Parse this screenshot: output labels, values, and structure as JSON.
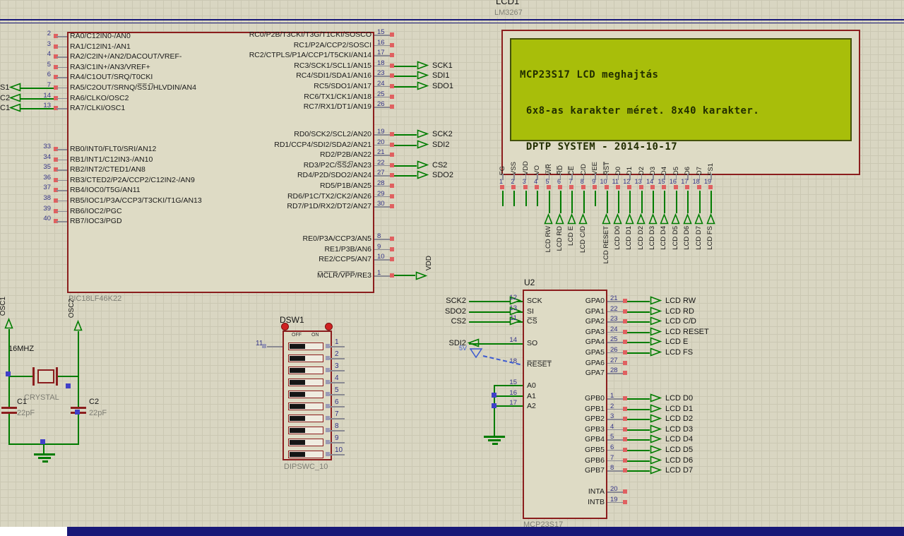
{
  "colors": {
    "background": "#d9d6c2",
    "grid": "#cbc8b3",
    "component_border": "#8b1d1d",
    "component_fill": "#dedbc5",
    "wire_green": "#007c00",
    "lcd_screen": "#a8be0a",
    "lcd_text": "#222e00",
    "sheet_border_blue": "#181878",
    "pin_number_blue": "#333388",
    "value_gray": "#7e7e74",
    "power_flag_blue": "#3c5ad0",
    "pin_endpoint_red": "#e06060",
    "junction_blue": "#4040c8"
  },
  "pic": {
    "value": "PIC18LF46K22",
    "mclr_power": "VDD",
    "left_a": [
      {
        "num": "2",
        "name": "RA0/C12IN0-/AN0"
      },
      {
        "num": "3",
        "name": "RA1/C12IN1-/AN1"
      },
      {
        "num": "4",
        "name": "RA2/C2IN+/AN2/DACOUT/VREF-"
      },
      {
        "num": "5",
        "name": "RA3/C1IN+/AN3/VREF+"
      },
      {
        "num": "6",
        "name": "RA4/C1OUT/SRQ/T0CKI"
      },
      {
        "num": "7",
        "name": "RA5/C2OUT/SRNQ/S̅S̅1̅/HLVDIN/AN4",
        "frag": "S1",
        "wire": "1"
      },
      {
        "num": "14",
        "name": "RA6/CLKO/OSC2",
        "frag": "C2",
        "wire": "1"
      },
      {
        "num": "13",
        "name": "RA7/CLKI/OSC1",
        "frag": "C1",
        "wire": "1"
      }
    ],
    "left_b": [
      {
        "num": "33",
        "name": "RB0/INT0/FLT0/SRI/AN12"
      },
      {
        "num": "34",
        "name": "RB1/INT1/C12IN3-/AN10"
      },
      {
        "num": "35",
        "name": "RB2/INT2/CTED1/AN8"
      },
      {
        "num": "36",
        "name": "RB3/CTED2/P2A/CCP2/C12IN2-/AN9"
      },
      {
        "num": "37",
        "name": "RB4/IOC0/T5G/AN11"
      },
      {
        "num": "38",
        "name": "RB5/IOC1/P3A/CCP3/T3CKI/T1G/AN13"
      },
      {
        "num": "39",
        "name": "RB6/IOC2/PGC"
      },
      {
        "num": "40",
        "name": "RB7/IOC3/PGD"
      }
    ],
    "right_rc": [
      {
        "name": "RC0/P2B/T3CKI/T3G/T1CKI/SOSCO",
        "num": "15"
      },
      {
        "name": "RC1/P2A/CCP2/SOSCI",
        "num": "16"
      },
      {
        "name": "RC2/CTPLS/P1A/CCP1/T5CKI/AN14",
        "num": "17"
      },
      {
        "name": "RC3/SCK1/SCL1/AN15",
        "num": "18",
        "net": "SCK1"
      },
      {
        "name": "RC4/SDI1/SDA1/AN16",
        "num": "23",
        "net": "SDI1"
      },
      {
        "name": "RC5/SDO1/AN17",
        "num": "24",
        "net": "SDO1"
      },
      {
        "name": "RC6/TX1/CK1/AN18",
        "num": "25"
      },
      {
        "name": "RC7/RX1/DT1/AN19",
        "num": "26"
      }
    ],
    "right_rd": [
      {
        "name": "RD0/SCK2/SCL2/AN20",
        "num": "19",
        "net": "SCK2"
      },
      {
        "name": "RD1/CCP4/SDI2/SDA2/AN21",
        "num": "20",
        "net": "SDI2"
      },
      {
        "name": "RD2/P2B/AN22",
        "num": "21"
      },
      {
        "name": "RD3/P2C/S̅S̅2̅/AN23",
        "num": "22",
        "net": "CS2"
      },
      {
        "name": "RD4/P2D/SDO2/AN24",
        "num": "27",
        "net": "SDO2"
      },
      {
        "name": "RD5/P1B/AN25",
        "num": "28"
      },
      {
        "name": "RD6/P1C/TX2/CK2/AN26",
        "num": "29"
      },
      {
        "name": "RD7/P1D/RX2/DT2/AN27",
        "num": "30"
      }
    ],
    "right_re": [
      {
        "name": "RE0/P3A/CCP3/AN5",
        "num": "8"
      },
      {
        "name": "RE1/P3B/AN6",
        "num": "9"
      },
      {
        "name": "RE2/CCP5/AN7",
        "num": "10"
      }
    ],
    "mclr_row": [
      {
        "name": "M̅C̅L̅R̅/V̅P̅P̅/RE3",
        "num": "1"
      }
    ]
  },
  "u2": {
    "ref": "U2",
    "value": "MCP23S17",
    "flag": "5V",
    "left_spi": [
      {
        "num": "12",
        "name": "SCK",
        "net": "SCK2",
        "dir": "in",
        "wire": "1"
      },
      {
        "num": "13",
        "name": "SI",
        "net": "SDO2",
        "dir": "in",
        "wire": "1"
      },
      {
        "num": "11",
        "name": "C̅S̅",
        "net": "CS2",
        "dir": "in",
        "wire": "1"
      }
    ],
    "so": [
      {
        "num": "14",
        "name": "SO",
        "net": "SDI2",
        "dir": "out",
        "wire": "1"
      }
    ],
    "reset": [
      {
        "num": "18",
        "name": "R̅E̅S̅E̅T̅"
      }
    ],
    "addr": [
      {
        "num": "15",
        "name": "A0"
      },
      {
        "num": "16",
        "name": "A1"
      },
      {
        "num": "17",
        "name": "A2"
      }
    ],
    "gpa": [
      {
        "name": "GPA0",
        "num": "21",
        "net": "LCD RW"
      },
      {
        "name": "GPA1",
        "num": "22",
        "net": "LCD RD"
      },
      {
        "name": "GPA2",
        "num": "23",
        "net": "LCD C/D"
      },
      {
        "name": "GPA3",
        "num": "24",
        "net": "LCD RESET"
      },
      {
        "name": "GPA4",
        "num": "25",
        "net": "LCD E"
      },
      {
        "name": "GPA5",
        "num": "26",
        "net": "LCD FS"
      },
      {
        "name": "GPA6",
        "num": "27"
      },
      {
        "name": "GPA7",
        "num": "28"
      }
    ],
    "gpb": [
      {
        "name": "GPB0",
        "num": "1",
        "net": "LCD D0"
      },
      {
        "name": "GPB1",
        "num": "2",
        "net": "LCD D1"
      },
      {
        "name": "GPB2",
        "num": "3",
        "net": "LCD D2"
      },
      {
        "name": "GPB3",
        "num": "4",
        "net": "LCD D3"
      },
      {
        "name": "GPB4",
        "num": "5",
        "net": "LCD D4"
      },
      {
        "name": "GPB5",
        "num": "6",
        "net": "LCD D5"
      },
      {
        "name": "GPB6",
        "num": "7",
        "net": "LCD D6"
      },
      {
        "name": "GPB7",
        "num": "8",
        "net": "LCD D7"
      }
    ],
    "int": [
      {
        "name": "INTA",
        "num": "20"
      },
      {
        "name": "INTB",
        "num": "19"
      }
    ]
  },
  "lcd": {
    "ref": "LCD1",
    "value": "LM3267",
    "lines": [
      "MCP23S17 LCD meghajtás",
      " 6x8-as karakter méret. 8x40 karakter.",
      " DPTP SYSTEM - 2014-10-17"
    ],
    "pins": [
      {
        "num": "1",
        "name": "FG",
        "pwr": "1"
      },
      {
        "num": "2",
        "name": "VSS",
        "pwr": "1"
      },
      {
        "num": "3",
        "name": "VDD",
        "pwr": "1"
      },
      {
        "num": "4",
        "name": "VO",
        "pwr": "1"
      },
      {
        "num": "5",
        "name": "W̅R̅",
        "net": "LCD RW"
      },
      {
        "num": "6",
        "name": "R̅D̅",
        "net": "LCD RD"
      },
      {
        "num": "7",
        "name": "C̅E̅",
        "net": "LCD E"
      },
      {
        "num": "8",
        "name": "C/D",
        "net": "LCD C/D"
      },
      {
        "num": "9",
        "name": "VEE",
        "pwr": "1"
      },
      {
        "num": "10",
        "name": "R̅S̅T̅",
        "net": "LCD RESET"
      },
      {
        "num": "11",
        "name": "D0",
        "net": "LCD D0"
      },
      {
        "num": "12",
        "name": "D1",
        "net": "LCD D1"
      },
      {
        "num": "13",
        "name": "D2",
        "net": "LCD D2"
      },
      {
        "num": "14",
        "name": "D3",
        "net": "LCD D3"
      },
      {
        "num": "15",
        "name": "D4",
        "net": "LCD D4"
      },
      {
        "num": "16",
        "name": "D5",
        "net": "LCD D5"
      },
      {
        "num": "17",
        "name": "D6",
        "net": "LCD D6"
      },
      {
        "num": "18",
        "name": "D7",
        "net": "LCD D7"
      },
      {
        "num": "19",
        "name": "FS1",
        "net": "LCD FS"
      }
    ]
  },
  "dsw": {
    "ref": "DSW1",
    "value": "DIPSWC_10",
    "off": "OFF",
    "on": "ON",
    "left_num": "11",
    "rows": [
      {
        "num": "1"
      },
      {
        "num": "2"
      },
      {
        "num": "3"
      },
      {
        "num": "4"
      },
      {
        "num": "5"
      },
      {
        "num": "6"
      },
      {
        "num": "7"
      },
      {
        "num": "8"
      },
      {
        "num": "9"
      },
      {
        "num": "10"
      }
    ]
  },
  "xtal": {
    "freq": "16MHZ",
    "value": "CRYSTAL",
    "osc1": "OSC1",
    "osc2": "OSC2",
    "c1_ref": "C1",
    "c1_val": "22pF",
    "c2_ref": "C2",
    "c2_val": "22pF"
  }
}
